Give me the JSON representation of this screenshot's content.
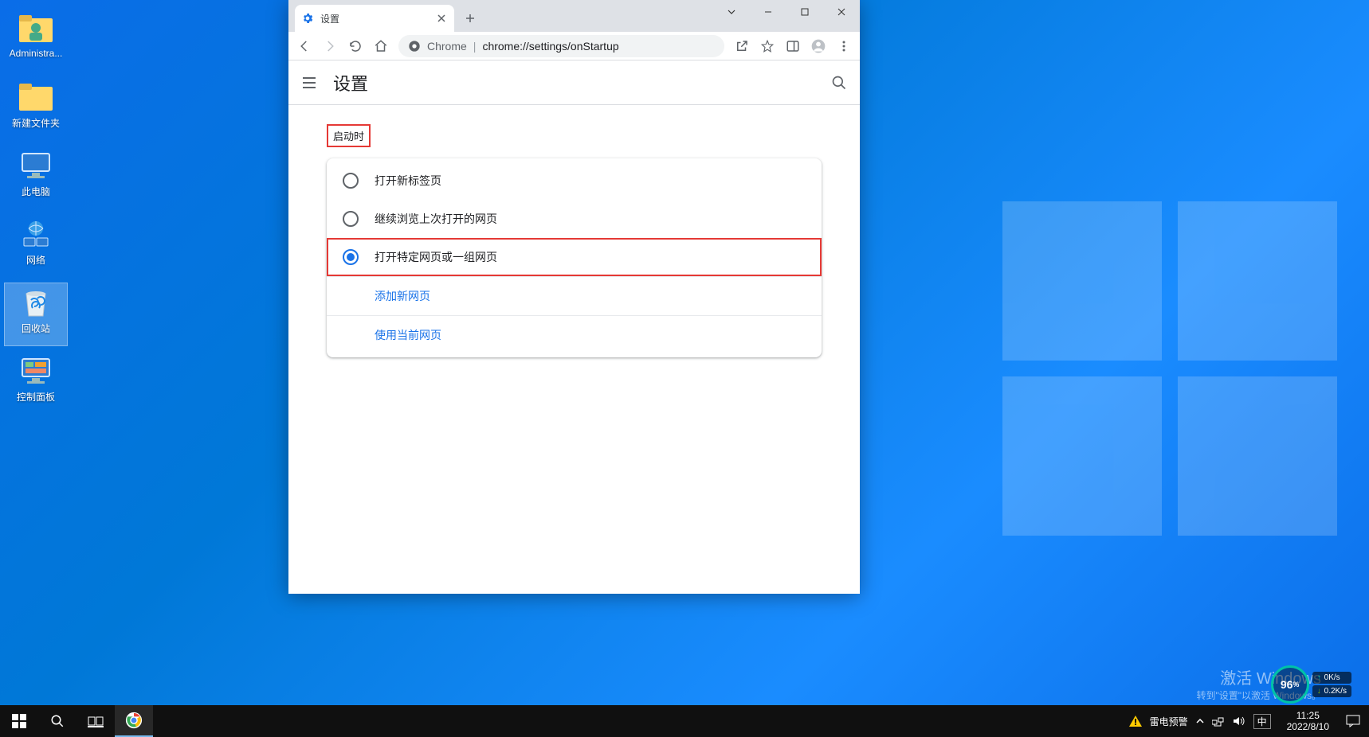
{
  "desktop_icons": {
    "administrator": "Administra...",
    "new_folder": "新建文件夹",
    "this_pc": "此电脑",
    "network": "网络",
    "recycle_bin": "回收站",
    "control_panel": "控制面板"
  },
  "chrome": {
    "tab_title": "设置",
    "omnibox_prefix": "Chrome",
    "omnibox_url": "chrome://settings/onStartup",
    "settings_title": "设置"
  },
  "settings": {
    "section_title": "启动时",
    "options": {
      "new_tab": "打开新标签页",
      "continue": "继续浏览上次打开的网页",
      "specific": "打开特定网页或一组网页"
    },
    "links": {
      "add_page": "添加新网页",
      "use_current": "使用当前网页"
    }
  },
  "watermark": {
    "line1": "激活 Windows",
    "line2": "转到\"设置\"以激活 Windows。"
  },
  "netwidget": {
    "pct": "96",
    "pct_unit": "%",
    "up": "0K/s",
    "down": "0.2K/s"
  },
  "taskbar": {
    "weather_alert": "雷电预警",
    "ime": "中",
    "time": "11:25",
    "date": "2022/8/10"
  }
}
